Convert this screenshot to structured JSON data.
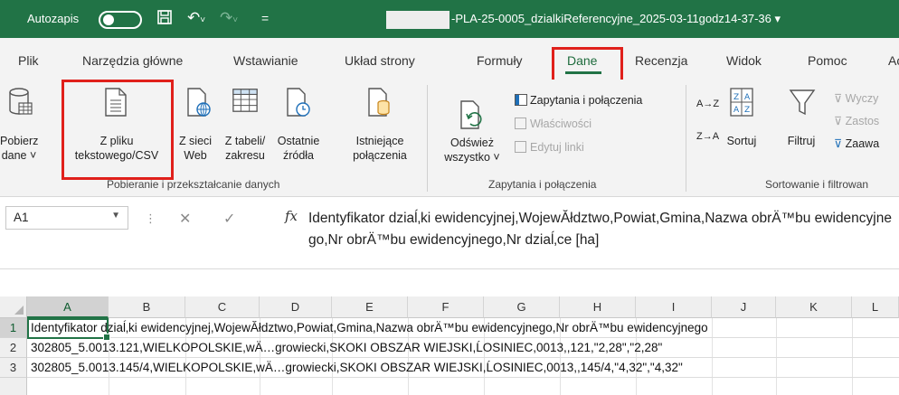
{
  "titlebar": {
    "autosave_label": "Autozapis",
    "filename": "-PLA-25-0005_dzialkiReferencyjne_2025-03-11godz14-37-36 ▾"
  },
  "tabs": [
    "Plik",
    "Narzędzia główne",
    "Wstawianie",
    "Układ strony",
    "Formuły",
    "Dane",
    "Recenzja",
    "Widok",
    "Pomoc",
    "Ac"
  ],
  "active_tab": "Dane",
  "ribbon": {
    "get_data": [
      "Pobierz",
      "dane ˅"
    ],
    "from_text": [
      "Z pliku",
      "tekstowego/CSV"
    ],
    "from_web": [
      "Z sieci",
      "Web"
    ],
    "from_table": [
      "Z tabeli/",
      "zakresu"
    ],
    "recent_sources": [
      "Ostatnie",
      "źródła"
    ],
    "existing_connections": [
      "Istniejące",
      "połączenia"
    ],
    "group_get": "Pobieranie i przekształcanie danych",
    "refresh_all": [
      "Odśwież",
      "wszystko ˅"
    ],
    "queries_connections": "Zapytania i połączenia",
    "properties": "Właściwości",
    "edit_links": "Edytuj linki",
    "group_queries": "Zapytania i połączenia",
    "sort_az": "A→Z",
    "sort_za": "Z→A",
    "sort": "Sortuj",
    "filter": "Filtruj",
    "clear": "Wyczy",
    "reapply": "Zastos",
    "advanced": "Zaawa",
    "group_sort": "Sortowanie i filtrowan"
  },
  "formula_bar": {
    "name_box": "A1",
    "fx": "fx",
    "content": "Identyfikator dziaĺ‚ki ewidencyjnej,WojewĂłdztwo,Powiat,Gmina,Nazwa obrÄ™bu ewidencyjnego,Nr obrÄ™bu ewidencyjnego,Nr dziaĺ‚ce [ha]"
  },
  "grid": {
    "columns": [
      "A",
      "B",
      "C",
      "D",
      "E",
      "F",
      "G",
      "H",
      "I",
      "J",
      "K",
      "L"
    ],
    "rows": [
      {
        "num": "1",
        "text": "Identyfikator dziaĺ‚ki ewidencyjnej,WojewĂłdztwo,Powiat,Gmina,Nazwa obrÄ™bu ewidencyjnego,Nr obrÄ™bu ewidencyjnego"
      },
      {
        "num": "2",
        "text": "302805_5.0013.121,WIELKOPOLSKIE,wÄ…growiecki,SKOKI OBSZAR WIEJSKI,ĹOSINIEC,0013,,121,\"2,28\",\"2,28\""
      },
      {
        "num": "3",
        "text": "302805_5.0013.145/4,WIELKOPOLSKIE,wÄ…growiecki,SKOKI OBSZAR WIEJSKI,ĹOSINIEC,0013,,145/4,\"4,32\",\"4,32\""
      }
    ]
  }
}
